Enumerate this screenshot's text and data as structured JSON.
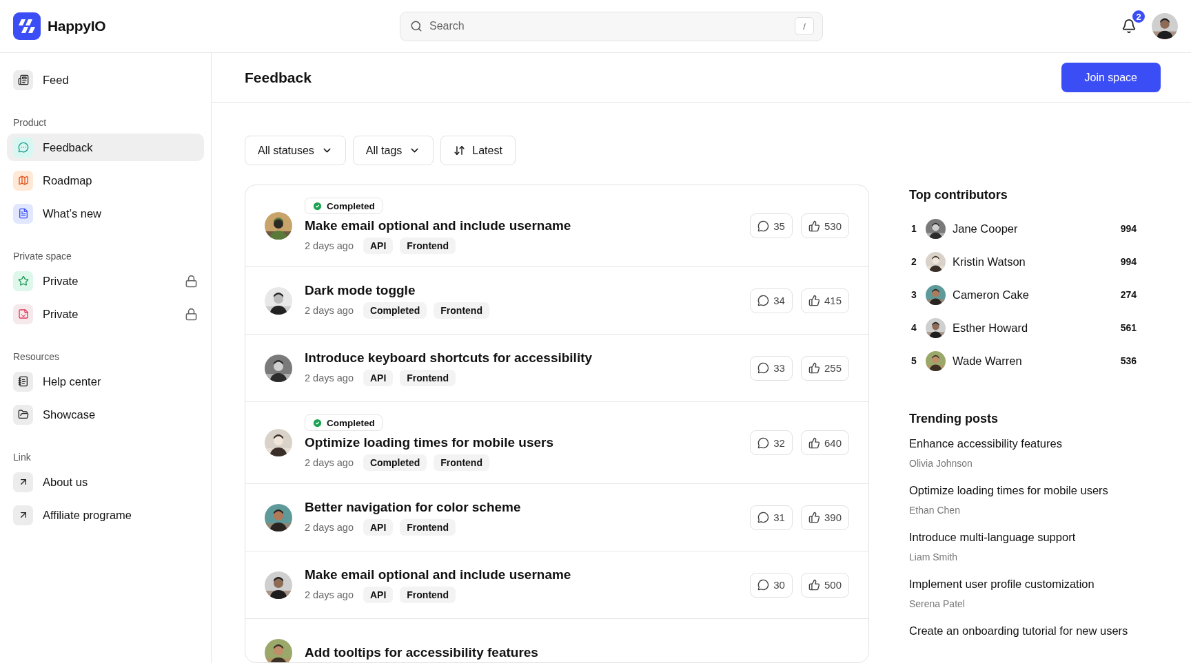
{
  "brand": {
    "name": "HappyIO"
  },
  "search": {
    "placeholder": "Search",
    "shortcut": "/"
  },
  "notifications": {
    "count": "2"
  },
  "sidebar": {
    "sections": [
      {
        "items": [
          {
            "label": "Feed",
            "selected": false,
            "locked": false
          }
        ]
      },
      {
        "title": "Product",
        "items": [
          {
            "label": "Feedback",
            "selected": true,
            "locked": false
          },
          {
            "label": "Roadmap",
            "selected": false,
            "locked": false
          },
          {
            "label": "What’s new",
            "selected": false,
            "locked": false
          }
        ]
      },
      {
        "title": "Private space",
        "items": [
          {
            "label": "Private",
            "selected": false,
            "locked": true
          },
          {
            "label": "Private",
            "selected": false,
            "locked": true
          }
        ]
      },
      {
        "title": "Resources",
        "items": [
          {
            "label": "Help center",
            "selected": false,
            "locked": false
          },
          {
            "label": "Showcase",
            "selected": false,
            "locked": false
          }
        ]
      },
      {
        "title": "Link",
        "items": [
          {
            "label": "About us",
            "selected": false,
            "locked": false
          },
          {
            "label": "Affiliate programe",
            "selected": false,
            "locked": false
          }
        ]
      }
    ]
  },
  "page": {
    "title": "Feedback",
    "action": "Join space"
  },
  "filters": [
    {
      "label": "All statuses",
      "kind": "dropdown"
    },
    {
      "label": "All tags",
      "kind": "dropdown"
    },
    {
      "label": "Latest",
      "kind": "sort"
    }
  ],
  "posts": [
    {
      "status": "Completed",
      "title": "Make email optional and include username",
      "time": "2 days ago",
      "tags": [
        "API",
        "Frontend"
      ],
      "comments": "35",
      "likes": "530"
    },
    {
      "title": "Dark mode toggle",
      "time": "2 days ago",
      "tags": [
        "Completed",
        "Frontend"
      ],
      "comments": "34",
      "likes": "415"
    },
    {
      "title": "Introduce keyboard shortcuts for accessibility",
      "time": "2 days ago",
      "tags": [
        "API",
        "Frontend"
      ],
      "comments": "33",
      "likes": "255"
    },
    {
      "status": "Completed",
      "title": "Optimize loading times for mobile users",
      "time": "2 days ago",
      "tags": [
        "Completed",
        "Frontend"
      ],
      "comments": "32",
      "likes": "640"
    },
    {
      "title": "Better navigation for color scheme",
      "time": "2 days ago",
      "tags": [
        "API",
        "Frontend"
      ],
      "comments": "31",
      "likes": "390"
    },
    {
      "title": "Make email optional and include username",
      "time": "2 days ago",
      "tags": [
        "API",
        "Frontend"
      ],
      "comments": "30",
      "likes": "500"
    },
    {
      "title": "Add tooltips for accessibility features"
    }
  ],
  "top_contributors": {
    "title": "Top contributors",
    "items": [
      {
        "rank": "1",
        "name": "Jane Cooper",
        "score": "994"
      },
      {
        "rank": "2",
        "name": "Kristin Watson",
        "score": "994"
      },
      {
        "rank": "3",
        "name": "Cameron Cake",
        "score": "274"
      },
      {
        "rank": "4",
        "name": "Esther Howard",
        "score": "561"
      },
      {
        "rank": "5",
        "name": "Wade Warren",
        "score": "536"
      }
    ]
  },
  "trending_posts": {
    "title": "Trending posts",
    "items": [
      {
        "title": "Enhance accessibility features",
        "author": "Olivia Johnson"
      },
      {
        "title": "Optimize loading times for mobile users",
        "author": "Ethan Chen"
      },
      {
        "title": "Introduce multi-language support",
        "author": "Liam Smith"
      },
      {
        "title": "Implement user profile customization",
        "author": "Serena Patel"
      },
      {
        "title": "Create an onboarding tutorial for new users"
      }
    ]
  }
}
